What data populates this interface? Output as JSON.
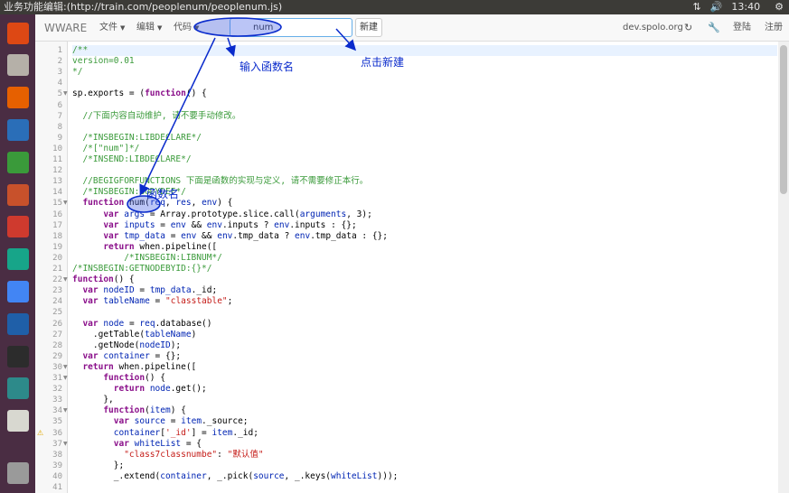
{
  "system_bar": {
    "window_title": "业务功能编辑:(http://train.com/peoplenum/peoplenum.js)",
    "clock": "13:40"
  },
  "launcher": {
    "items": [
      {
        "name": "ubuntu-dash-icon",
        "color": "#dd4814"
      },
      {
        "name": "files-icon",
        "color": "#b5b0a8"
      },
      {
        "name": "firefox-icon",
        "color": "#e66000"
      },
      {
        "name": "writer-icon",
        "color": "#2a6eb8"
      },
      {
        "name": "calc-icon",
        "color": "#3a9a3a"
      },
      {
        "name": "impress-icon",
        "color": "#c8512b"
      },
      {
        "name": "settings-icon",
        "color": "#cf3a2e"
      },
      {
        "name": "app-green-icon",
        "color": "#17a589"
      },
      {
        "name": "chrome-icon",
        "color": "#4285f4"
      },
      {
        "name": "monitor-icon",
        "color": "#1f5fa8"
      },
      {
        "name": "terminal-icon",
        "color": "#2c2c2c"
      },
      {
        "name": "camera-icon",
        "color": "#2d8a8a"
      },
      {
        "name": "editor-icon",
        "color": "#d8d8d0"
      },
      {
        "name": "trash-icon",
        "color": "#9a9a9a"
      }
    ]
  },
  "toolbar": {
    "brand": "WWARE",
    "menus": [
      "文件",
      "编辑",
      "代码"
    ],
    "search_value": "num",
    "new_button": "新建",
    "host": "dev.spolo.org",
    "login": "登陆",
    "register": "注册"
  },
  "editor": {
    "lines": [
      {
        "n": 1,
        "segs": [
          [
            "cmt",
            "/**"
          ]
        ]
      },
      {
        "n": 2,
        "segs": [
          [
            "cmt",
            "version=0.01"
          ]
        ]
      },
      {
        "n": 3,
        "segs": [
          [
            "cmt",
            "*/"
          ]
        ]
      },
      {
        "n": 4,
        "segs": []
      },
      {
        "n": 5,
        "segs": [
          [
            "",
            "sp.exports = ("
          ],
          [
            "kw",
            "function"
          ],
          [
            "",
            "() {"
          ]
        ]
      },
      {
        "n": 6,
        "segs": []
      },
      {
        "n": 7,
        "segs": [
          [
            "cmt",
            "  //下面内容自动维护, 请不要手动修改。"
          ]
        ]
      },
      {
        "n": 8,
        "segs": []
      },
      {
        "n": 9,
        "segs": [
          [
            "cmt",
            "  /*INSBEGIN:LIBDECLARE*/"
          ]
        ]
      },
      {
        "n": 10,
        "segs": [
          [
            "cmt",
            "  /*[\"num\"]*/"
          ]
        ]
      },
      {
        "n": 11,
        "segs": [
          [
            "cmt",
            "  /*INSEND:LIBDECLARE*/"
          ]
        ]
      },
      {
        "n": 12,
        "segs": []
      },
      {
        "n": 13,
        "segs": [
          [
            "cmt",
            "  //BEGIGFORFUNCTIONS 下面是函数的实现与定义, 请不需要修正本行。"
          ]
        ]
      },
      {
        "n": 14,
        "segs": [
          [
            "cmt",
            "  /*INSBEGIN:BODYDEF*/"
          ]
        ]
      },
      {
        "n": 15,
        "segs": [
          [
            "kw",
            "  function"
          ],
          [
            "",
            " num("
          ],
          [
            "var",
            "req"
          ],
          [
            "",
            ", "
          ],
          [
            "var",
            "res"
          ],
          [
            "",
            ", "
          ],
          [
            "var",
            "env"
          ],
          [
            "",
            ") {"
          ]
        ]
      },
      {
        "n": 16,
        "segs": [
          [
            "kw",
            "      var"
          ],
          [
            "",
            " "
          ],
          [
            "var",
            "args"
          ],
          [
            "",
            " = Array.prototype.slice.call("
          ],
          [
            "var",
            "arguments"
          ],
          [
            "",
            ", 3);"
          ]
        ]
      },
      {
        "n": 17,
        "segs": [
          [
            "kw",
            "      var"
          ],
          [
            "",
            " "
          ],
          [
            "var",
            "inputs"
          ],
          [
            "",
            " = "
          ],
          [
            "var",
            "env"
          ],
          [
            "",
            " && "
          ],
          [
            "var",
            "env"
          ],
          [
            "",
            ".inputs ? "
          ],
          [
            "var",
            "env"
          ],
          [
            "",
            ".inputs : {};"
          ]
        ]
      },
      {
        "n": 18,
        "segs": [
          [
            "kw",
            "      var"
          ],
          [
            "",
            " "
          ],
          [
            "var",
            "tmp_data"
          ],
          [
            "",
            " = "
          ],
          [
            "var",
            "env"
          ],
          [
            "",
            " && "
          ],
          [
            "var",
            "env"
          ],
          [
            "",
            ".tmp_data ? "
          ],
          [
            "var",
            "env"
          ],
          [
            "",
            ".tmp_data : {};"
          ]
        ]
      },
      {
        "n": 19,
        "segs": [
          [
            "kw",
            "      return"
          ],
          [
            "",
            " when.pipeline(["
          ]
        ]
      },
      {
        "n": 20,
        "segs": [
          [
            "cmt",
            "          /*INSBEGIN:LIBNUM*/"
          ]
        ]
      },
      {
        "n": 21,
        "segs": [
          [
            "cmt",
            "/*INSBEGIN:GETNODEBYID:{}*/"
          ]
        ]
      },
      {
        "n": 22,
        "segs": [
          [
            "kw",
            "function"
          ],
          [
            "",
            "() {"
          ]
        ]
      },
      {
        "n": 23,
        "segs": [
          [
            "kw",
            "  var"
          ],
          [
            "",
            " "
          ],
          [
            "var",
            "nodeID"
          ],
          [
            "",
            " = "
          ],
          [
            "var",
            "tmp_data"
          ],
          [
            "",
            "._id;"
          ]
        ]
      },
      {
        "n": 24,
        "segs": [
          [
            "kw",
            "  var"
          ],
          [
            "",
            " "
          ],
          [
            "var",
            "tableName"
          ],
          [
            "",
            " = "
          ],
          [
            "str",
            "\"classtable\""
          ],
          [
            "",
            ";"
          ]
        ]
      },
      {
        "n": 25,
        "segs": []
      },
      {
        "n": 26,
        "segs": [
          [
            "kw",
            "  var"
          ],
          [
            "",
            " "
          ],
          [
            "var",
            "node"
          ],
          [
            "",
            " = "
          ],
          [
            "var",
            "req"
          ],
          [
            "",
            ".database()"
          ]
        ]
      },
      {
        "n": 27,
        "segs": [
          [
            "",
            "    .getTable("
          ],
          [
            "var",
            "tableName"
          ],
          [
            "",
            ")"
          ]
        ]
      },
      {
        "n": 28,
        "segs": [
          [
            "",
            "    .getNode("
          ],
          [
            "var",
            "nodeID"
          ],
          [
            "",
            ");"
          ]
        ]
      },
      {
        "n": 29,
        "segs": [
          [
            "kw",
            "  var"
          ],
          [
            "",
            " "
          ],
          [
            "var",
            "container"
          ],
          [
            "",
            " = {};"
          ]
        ]
      },
      {
        "n": 30,
        "segs": [
          [
            "kw",
            "  return"
          ],
          [
            "",
            " when.pipeline(["
          ]
        ]
      },
      {
        "n": 31,
        "segs": [
          [
            "kw",
            "      function"
          ],
          [
            "",
            "() {"
          ]
        ]
      },
      {
        "n": 32,
        "segs": [
          [
            "kw",
            "        return"
          ],
          [
            "",
            " "
          ],
          [
            "var",
            "node"
          ],
          [
            "",
            ".get();"
          ]
        ]
      },
      {
        "n": 33,
        "segs": [
          [
            "",
            "      },"
          ]
        ]
      },
      {
        "n": 34,
        "segs": [
          [
            "kw",
            "      function"
          ],
          [
            "",
            "("
          ],
          [
            "var",
            "item"
          ],
          [
            "",
            ") {"
          ]
        ]
      },
      {
        "n": 35,
        "segs": [
          [
            "kw",
            "        var"
          ],
          [
            "",
            " "
          ],
          [
            "var",
            "source"
          ],
          [
            "",
            " = "
          ],
          [
            "var",
            "item"
          ],
          [
            "",
            "._source;"
          ]
        ]
      },
      {
        "n": 36,
        "segs": [
          [
            "var",
            "        container"
          ],
          [
            "",
            "["
          ],
          [
            "str",
            "'_id'"
          ],
          [
            "",
            "] = "
          ],
          [
            "var",
            "item"
          ],
          [
            "",
            "._id;"
          ]
        ]
      },
      {
        "n": 37,
        "segs": [
          [
            "kw",
            "        var"
          ],
          [
            "",
            " "
          ],
          [
            "var",
            "whiteList"
          ],
          [
            "",
            " = {"
          ]
        ]
      },
      {
        "n": 38,
        "segs": [
          [
            "str",
            "          \"class7classnumbe\""
          ],
          [
            "",
            ": "
          ],
          [
            "str",
            "\"默认值\""
          ]
        ]
      },
      {
        "n": 39,
        "segs": [
          [
            "",
            "        };"
          ]
        ]
      },
      {
        "n": 40,
        "segs": [
          [
            "",
            "        _.extend("
          ],
          [
            "var",
            "container"
          ],
          [
            "",
            ", _.pick("
          ],
          [
            "var",
            "source"
          ],
          [
            "",
            ", _.keys("
          ],
          [
            "var",
            "whiteList"
          ],
          [
            "",
            ")));"
          ]
        ]
      },
      {
        "n": 41,
        "segs": [
          [
            "",
            "        "
          ]
        ]
      }
    ],
    "folds": [
      5,
      15,
      22,
      30,
      31,
      34,
      37
    ],
    "warning_line": 36
  },
  "annotations": {
    "input_function_name": "输入函数名",
    "click_new": "点击新建",
    "function_name": "函数名",
    "color": "#0a2bcc"
  }
}
